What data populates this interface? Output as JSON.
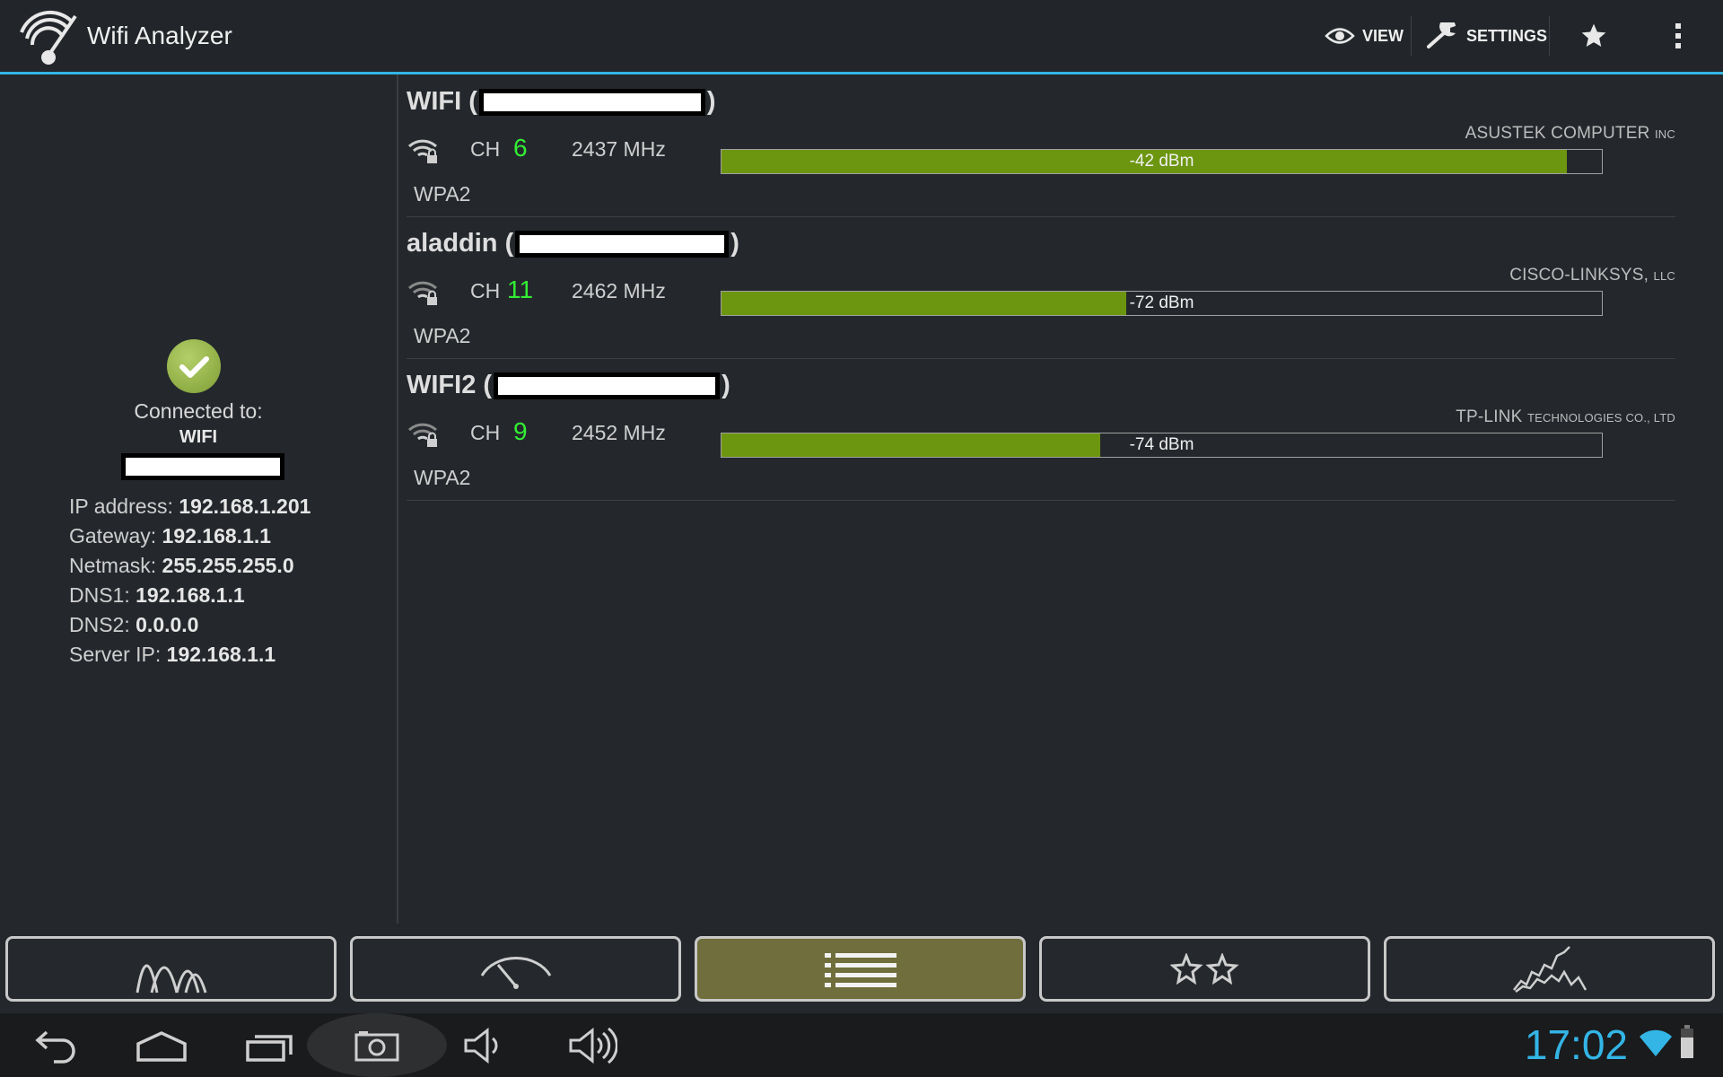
{
  "app": {
    "title": "Wifi Analyzer"
  },
  "actions": {
    "view_label": "VIEW",
    "settings_label": "SETTINGS"
  },
  "colors": {
    "accent": "#33b5e5",
    "signal": "#6c960f",
    "channel": "#33ee33",
    "active_tab": "#6f6e3c"
  },
  "connection": {
    "connected_label": "Connected to:",
    "ssid": "WIFI",
    "info": [
      {
        "label": "IP address:",
        "value": "192.168.1.201"
      },
      {
        "label": "Gateway:",
        "value": "192.168.1.1"
      },
      {
        "label": "Netmask:",
        "value": "255.255.255.0"
      },
      {
        "label": "DNS1:",
        "value": "192.168.1.1"
      },
      {
        "label": "DNS2:",
        "value": "0.0.0.0"
      },
      {
        "label": "Server IP:",
        "value": "192.168.1.1"
      }
    ]
  },
  "aps": [
    {
      "ssid": "WIFI",
      "ch_label": "CH",
      "channel": "6",
      "freq": "2437 MHz",
      "vendor": "ASUSTEK COMPUTER",
      "vendor_suffix": "INC",
      "signal": "-42 dBm",
      "signal_pct": 96,
      "security": "WPA2"
    },
    {
      "ssid": "aladdin",
      "ch_label": "CH",
      "channel": "11",
      "freq": "2462 MHz",
      "vendor": "CISCO-LINKSYS,",
      "vendor_suffix": "LLC",
      "signal": "-72 dBm",
      "signal_pct": 46,
      "security": "WPA2"
    },
    {
      "ssid": "WIFI2",
      "ch_label": "CH",
      "channel": "9",
      "freq": "2452 MHz",
      "vendor": "TP-LINK",
      "vendor_suffix": "TECHNOLOGIES CO., LTD",
      "signal": "-74 dBm",
      "signal_pct": 43,
      "security": "WPA2"
    }
  ],
  "tabs": [
    {
      "name": "channel-graph",
      "icon": "channel-graph-icon",
      "active": false
    },
    {
      "name": "signal-meter",
      "icon": "signal-meter-icon",
      "active": false
    },
    {
      "name": "ap-list",
      "icon": "list-icon",
      "active": true
    },
    {
      "name": "channel-rating",
      "icon": "stars-icon",
      "active": false
    },
    {
      "name": "time-graph",
      "icon": "time-graph-icon",
      "active": false
    }
  ],
  "system": {
    "clock": "17:02"
  }
}
